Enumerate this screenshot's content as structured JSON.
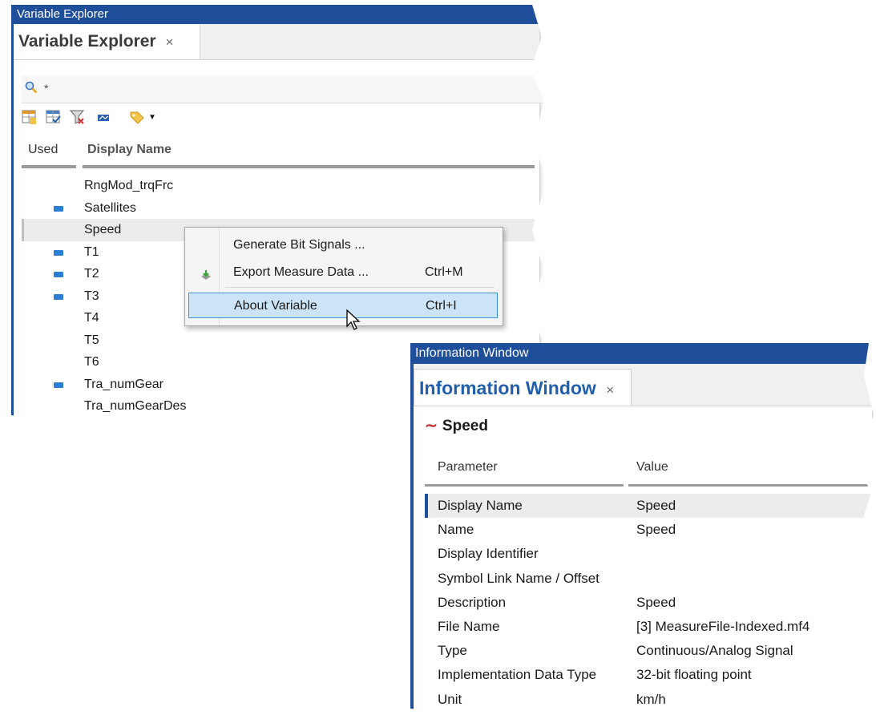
{
  "variable_explorer": {
    "window_title": "Variable Explorer",
    "tab_label": "Variable Explorer",
    "tab_close": "×",
    "search_text": "*",
    "columns": {
      "used": "Used",
      "display_name": "Display Name"
    },
    "rows": [
      {
        "name": "RngMod_trqFrc",
        "used": false
      },
      {
        "name": "Satellites",
        "used": true
      },
      {
        "name": "Speed",
        "used": false,
        "selected": true
      },
      {
        "name": "T1",
        "used": true
      },
      {
        "name": "T2",
        "used": true
      },
      {
        "name": "T3",
        "used": true
      },
      {
        "name": "T4",
        "used": false
      },
      {
        "name": "T5",
        "used": false
      },
      {
        "name": "T6",
        "used": false
      },
      {
        "name": "Tra_numGear",
        "used": true
      },
      {
        "name": "Tra_numGearDes",
        "used": false
      }
    ]
  },
  "context_menu": {
    "items": [
      {
        "label": "Generate Bit Signals ...",
        "shortcut": ""
      },
      {
        "label": "Export Measure Data ...",
        "shortcut": "Ctrl+M"
      },
      {
        "label": "About Variable",
        "shortcut": "Ctrl+I"
      }
    ]
  },
  "information_window": {
    "window_title": "Information Window",
    "tab_label": "Information Window",
    "tab_close": "×",
    "variable_name": "Speed",
    "columns": {
      "parameter": "Parameter",
      "value": "Value"
    },
    "rows": [
      {
        "parameter": "Display Name",
        "value": "Speed"
      },
      {
        "parameter": "Name",
        "value": "Speed"
      },
      {
        "parameter": "Display Identifier",
        "value": ""
      },
      {
        "parameter": "Symbol Link Name / Offset",
        "value": ""
      },
      {
        "parameter": "Description",
        "value": "Speed"
      },
      {
        "parameter": "File Name",
        "value": "[3] MeasureFile-Indexed.mf4"
      },
      {
        "parameter": "Type",
        "value": "Continuous/Analog Signal"
      },
      {
        "parameter": "Implementation Data Type",
        "value": "32-bit floating point"
      },
      {
        "parameter": "Unit",
        "value": "km/h"
      }
    ]
  },
  "colors": {
    "title_bar": "#1f4e9a",
    "used_marker": "#2a7fd4",
    "menu_highlight": "#cce4f7",
    "signal_icon": "#c0282d"
  }
}
